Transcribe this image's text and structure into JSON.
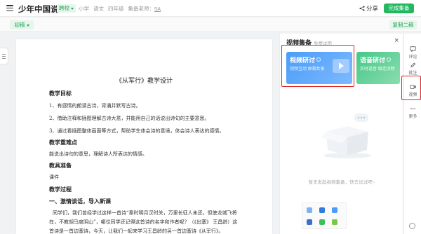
{
  "header": {
    "title": "少年中国说",
    "tag": "跨校",
    "meta": [
      "小学",
      "语文",
      "四年级"
    ],
    "teacher_label": "集备老师：",
    "teacher_name": "5A",
    "share_label": "分享",
    "done_label": "完成集备"
  },
  "toolbar": {
    "draft_label": "初稿",
    "copy_label": "复制二稿"
  },
  "document": {
    "title": "《从军行》教学设计",
    "lines": [
      {
        "type": "heading",
        "text": "教学目标"
      },
      {
        "type": "text",
        "text": "1、有感情的朗读古诗，背诵并默写古诗。"
      },
      {
        "type": "text",
        "text": "2、借助注释和插图理解古诗大意，并能用自己的话说出诗句的主要意思。"
      },
      {
        "type": "text",
        "text": "3、通过看插图整体画面等方式，帮助学生体会诗的意境，体会诗人表达的感情。"
      },
      {
        "type": "heading",
        "text": "教学重难点"
      },
      {
        "type": "text",
        "text": "能说出诗句的意思，理解诗人所表达的情感。"
      },
      {
        "type": "heading",
        "text": "教具准备"
      },
      {
        "type": "text",
        "text": "课件"
      },
      {
        "type": "heading",
        "text": "教学过程"
      },
      {
        "type": "heading",
        "text": "一、激情谈话，导入新课"
      },
      {
        "type": "text",
        "text": "同学们，我们曾经学过这样一首诗“秦时明月汉时关，万里长征人未还。但使龙城飞将"
      },
      {
        "type": "text",
        "text": "在，不教胡马度阴山”，哪位同学还记得这首诗的名字和作者呢？（《出塞》 王昌龄）这"
      },
      {
        "type": "text",
        "text": "首诗是一首边塞诗，今天，让我们一起来学习王昌龄的另一首边塞诗《从军行》。"
      }
    ]
  },
  "panel": {
    "title": "视频集备",
    "subtitle": "免费试用",
    "close_symbol": "×",
    "cards": [
      {
        "title": "视频研讨",
        "desc": "视频互动  屏幕共享"
      },
      {
        "title": "语音研讨",
        "desc": "实时语音  稳定流畅"
      }
    ],
    "empty_text": "暂无发起视频集备，快去试试吧~"
  },
  "rail": {
    "items": [
      {
        "label": "评论",
        "icon": "comment-icon"
      },
      {
        "label": "批注",
        "icon": "annotate-icon"
      },
      {
        "label": "视频",
        "icon": "video-icon"
      },
      {
        "label": "更多",
        "icon": "more-icon"
      }
    ]
  },
  "colors": {
    "accent_green": "#22b861",
    "video_card": "#4a9df8",
    "voice_card": "#45c887",
    "highlight_red": "#e02424"
  }
}
